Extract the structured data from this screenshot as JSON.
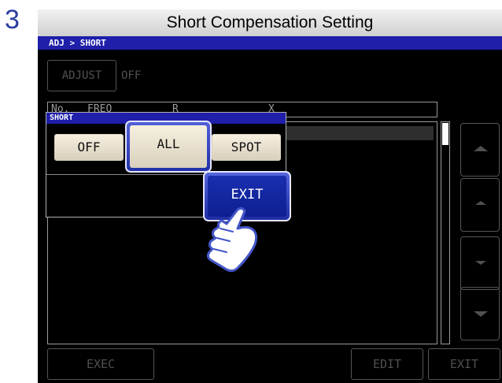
{
  "step": {
    "number": "3"
  },
  "title": "Short Compensation Setting",
  "screen": {
    "breadcrumb": "ADJ > SHORT",
    "adjust": {
      "label": "ADJUST",
      "value": "OFF"
    },
    "table": {
      "headers": [
        "No.",
        "FREQ",
        "R",
        "X"
      ]
    },
    "popup": {
      "title": "SHORT",
      "options": [
        "OFF",
        "ALL",
        "SPOT"
      ],
      "selected": "ALL",
      "exit_label": "EXIT"
    },
    "side_buttons": [
      "page-up",
      "line-up",
      "line-down",
      "page-down"
    ],
    "bottom_buttons": {
      "exec": "EXEC",
      "edit": "EDIT",
      "exit": "EXIT"
    }
  },
  "colors": {
    "accent": "#1f1faa",
    "step_number": "#2a3f9e",
    "option_button": "#ece4d0",
    "disabled_text": "#505050"
  },
  "icons": [
    "pointing-hand-icon",
    "page-up-icon",
    "line-up-icon",
    "line-down-icon",
    "page-down-icon"
  ]
}
